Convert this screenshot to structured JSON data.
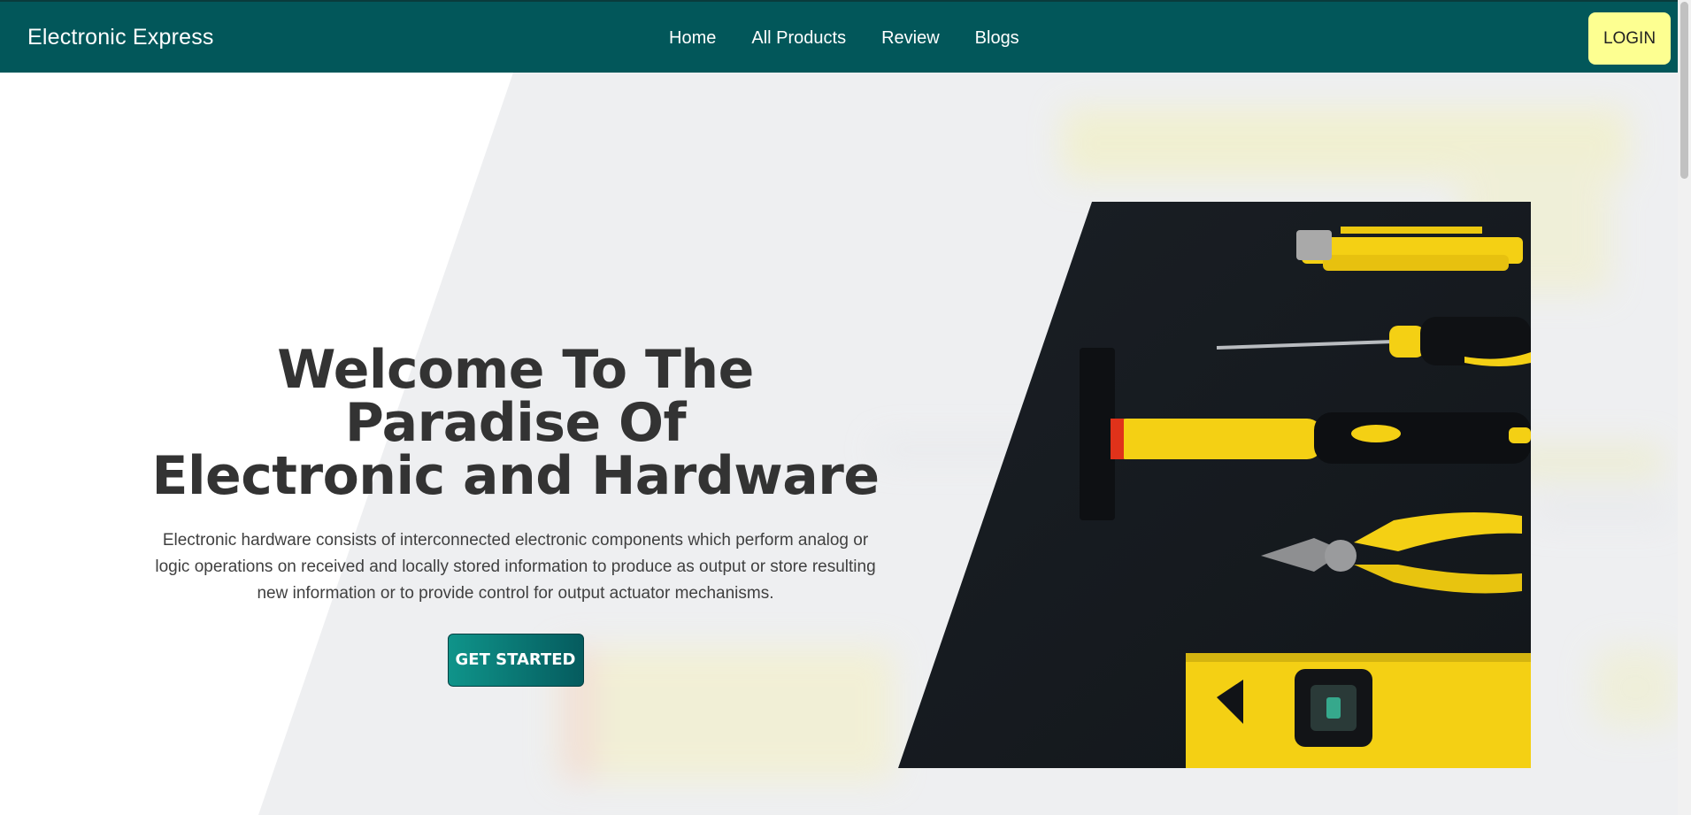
{
  "navbar": {
    "brand": "Electronic Express",
    "links": [
      "Home",
      "All Products",
      "Review",
      "Blogs"
    ],
    "login_label": "LOGIN"
  },
  "hero": {
    "title_line1": "Welcome To The Paradise Of",
    "title_line2": "Electronic and Hardware",
    "description": "Electronic hardware consists of interconnected electronic components which perform analog or logic operations on received and locally stored information to produce as output or store resulting new information or to provide control for output actuator mechanisms.",
    "cta_label": "GET STARTED"
  },
  "colors": {
    "navbar": "#02575a",
    "login_bg": "#fdff91",
    "cta_start": "#0f948a",
    "cta_end": "#055b5e",
    "tool_yellow": "#f5d212",
    "image_bg": "#161a1f"
  },
  "icons": {
    "hero_image": "tools-photo"
  }
}
